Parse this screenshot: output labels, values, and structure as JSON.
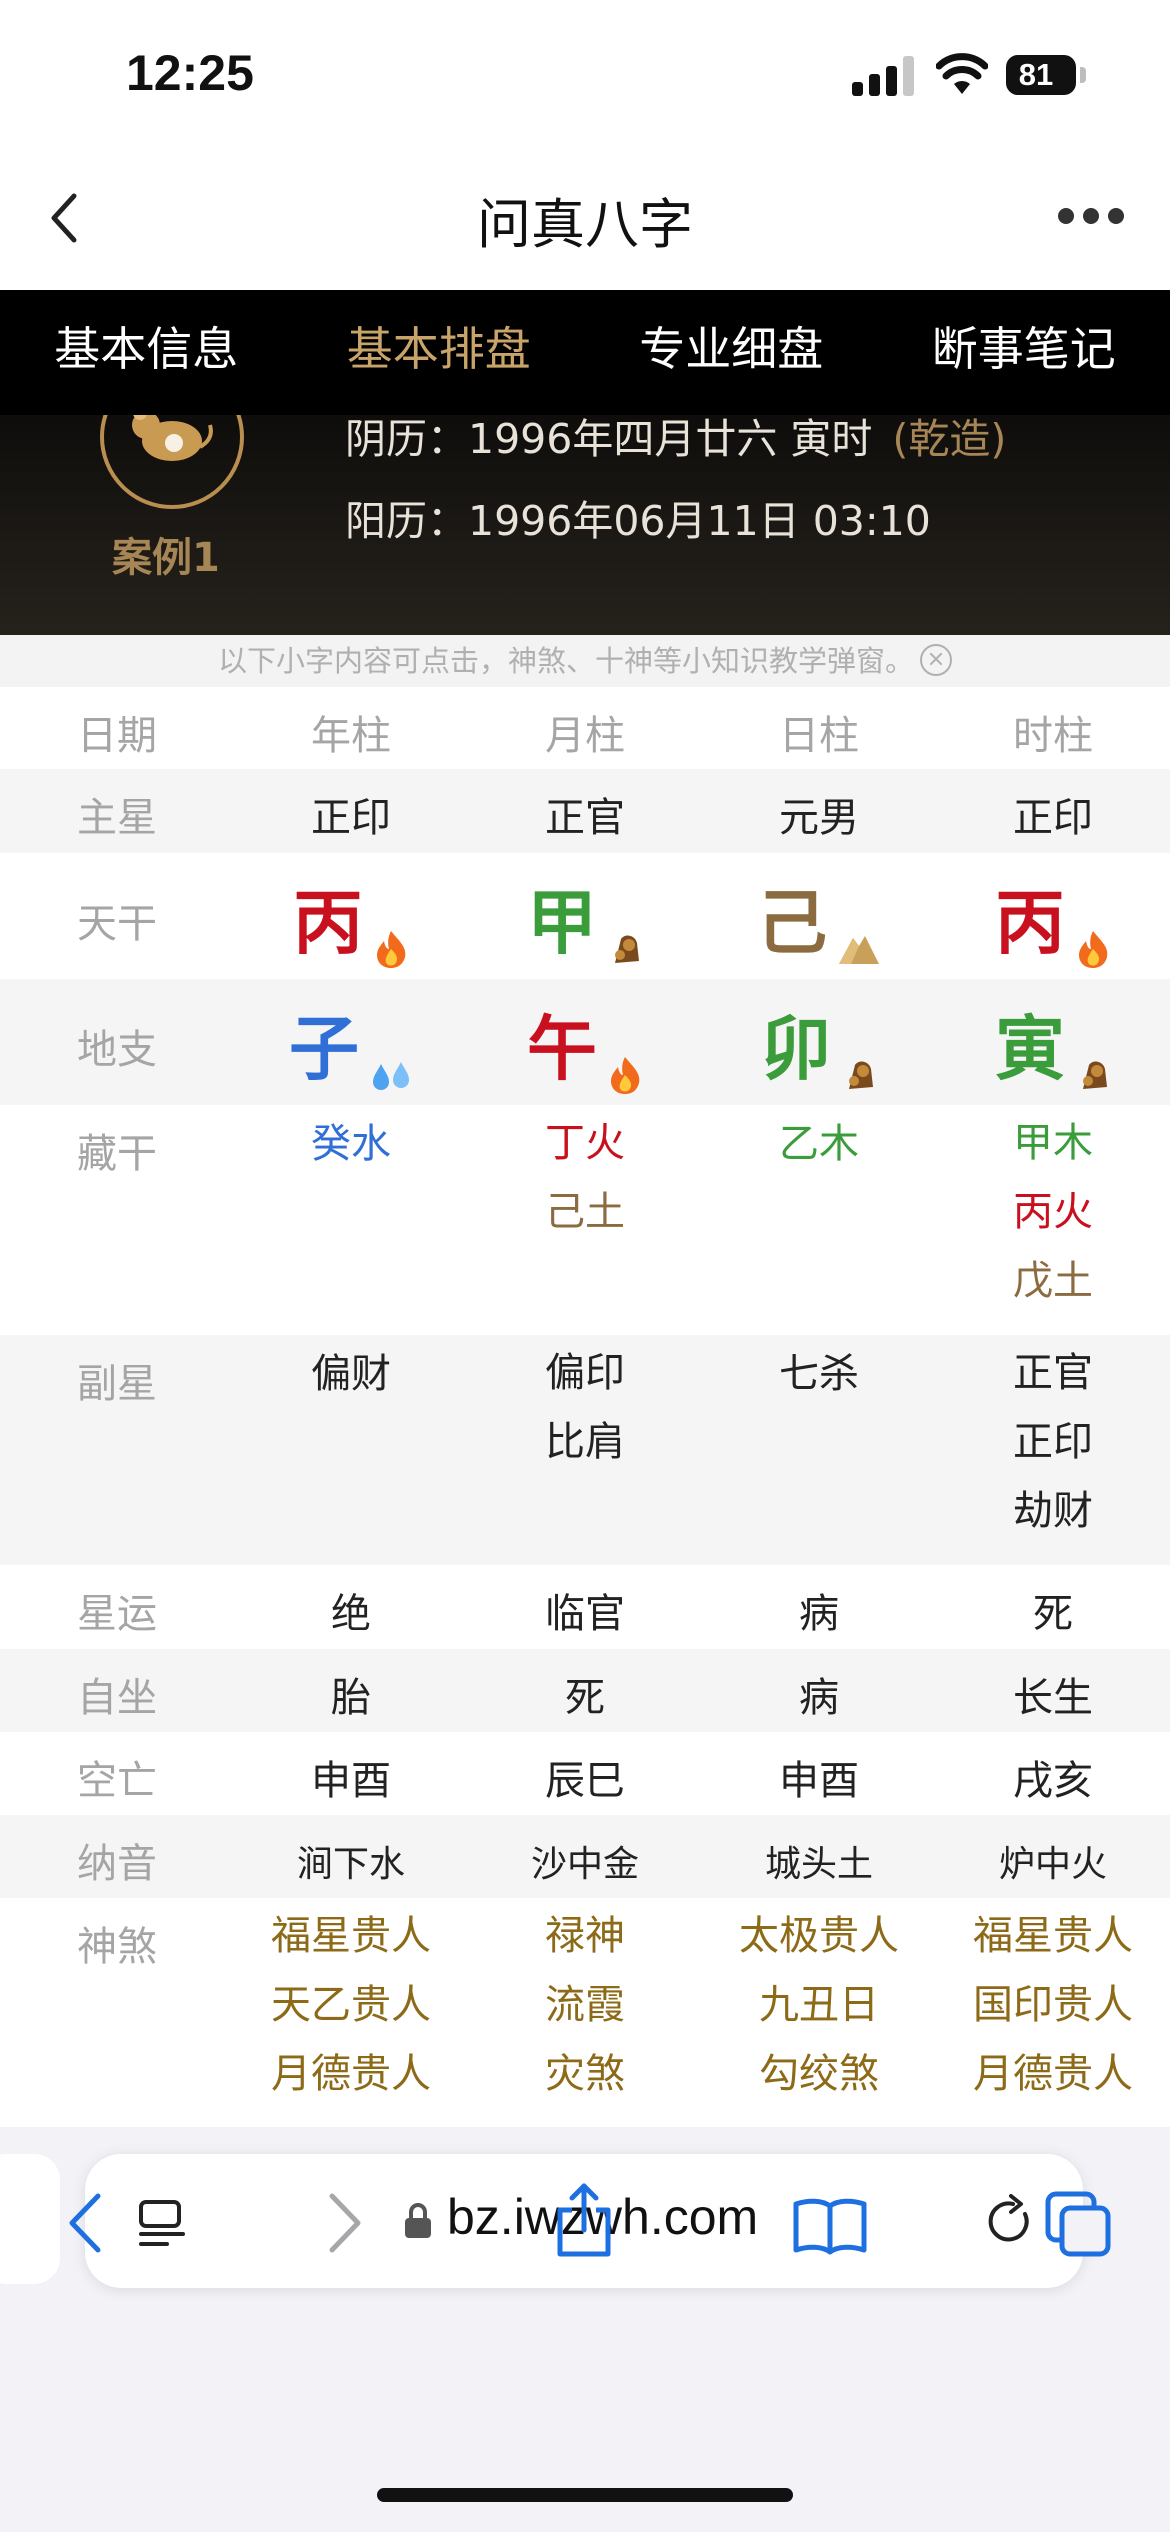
{
  "status_bar": {
    "time": "12:25",
    "battery": "81"
  },
  "nav": {
    "title": "问真八字"
  },
  "tabs": [
    {
      "label": "基本信息",
      "active": false
    },
    {
      "label": "基本排盘",
      "active": true
    },
    {
      "label": "专业细盘",
      "active": false
    },
    {
      "label": "断事笔记",
      "active": false
    }
  ],
  "header": {
    "case_label": "案例1",
    "lunar": "阴历：1996年四月廿六 寅时",
    "gender": "(乾造)",
    "solar": "阳历：1996年06月11日 03:10"
  },
  "tip": "以下小字内容可点击，神煞、十神等小知识教学弹窗。",
  "table": {
    "header": {
      "label": "日期",
      "cols": [
        "年柱",
        "月柱",
        "日柱",
        "时柱"
      ]
    },
    "main_star": {
      "label": "主星",
      "cols": [
        "正印",
        "正官",
        "元男",
        "正印"
      ]
    },
    "heavenly_stem": {
      "label": "天干",
      "cols": [
        "丙",
        "甲",
        "己",
        "丙"
      ]
    },
    "earthly_branch": {
      "label": "地支",
      "cols": [
        "子",
        "午",
        "卯",
        "寅"
      ]
    },
    "hidden_stems": {
      "label": "藏干",
      "cols": [
        [
          "癸水"
        ],
        [
          "丁火",
          "己土"
        ],
        [
          "乙木"
        ],
        [
          "甲木",
          "丙火",
          "戊土"
        ]
      ]
    },
    "sub_star": {
      "label": "副星",
      "cols": [
        [
          "偏财"
        ],
        [
          "偏印",
          "比肩"
        ],
        [
          "七杀"
        ],
        [
          "正官",
          "正印",
          "劫财"
        ]
      ]
    },
    "star_luck": {
      "label": "星运",
      "cols": [
        "绝",
        "临官",
        "病",
        "死"
      ]
    },
    "self_sit": {
      "label": "自坐",
      "cols": [
        "胎",
        "死",
        "病",
        "长生"
      ]
    },
    "void": {
      "label": "空亡",
      "cols": [
        "申酉",
        "辰巳",
        "申酉",
        "戌亥"
      ]
    },
    "nayin": {
      "label": "纳音",
      "cols": [
        "涧下水",
        "沙中金",
        "城头土",
        "炉中火"
      ]
    },
    "shensha": {
      "label": "神煞",
      "cols": [
        [
          "福星贵人",
          "天乙贵人",
          "月德贵人"
        ],
        [
          "禄神",
          "流霞",
          "灾煞"
        ],
        [
          "太极贵人",
          "九丑日",
          "勾绞煞"
        ],
        [
          "福星贵人",
          "国印贵人",
          "月德贵人"
        ]
      ]
    }
  },
  "browser": {
    "url": "bz.iwzwh.com"
  },
  "colors": {
    "fire": "#c8101e",
    "wood": "#3a9c3a",
    "earth": "#8b6b3f",
    "water": "#2f6fd6",
    "gold": "#8d6a17",
    "accent": "#c9a46a"
  }
}
